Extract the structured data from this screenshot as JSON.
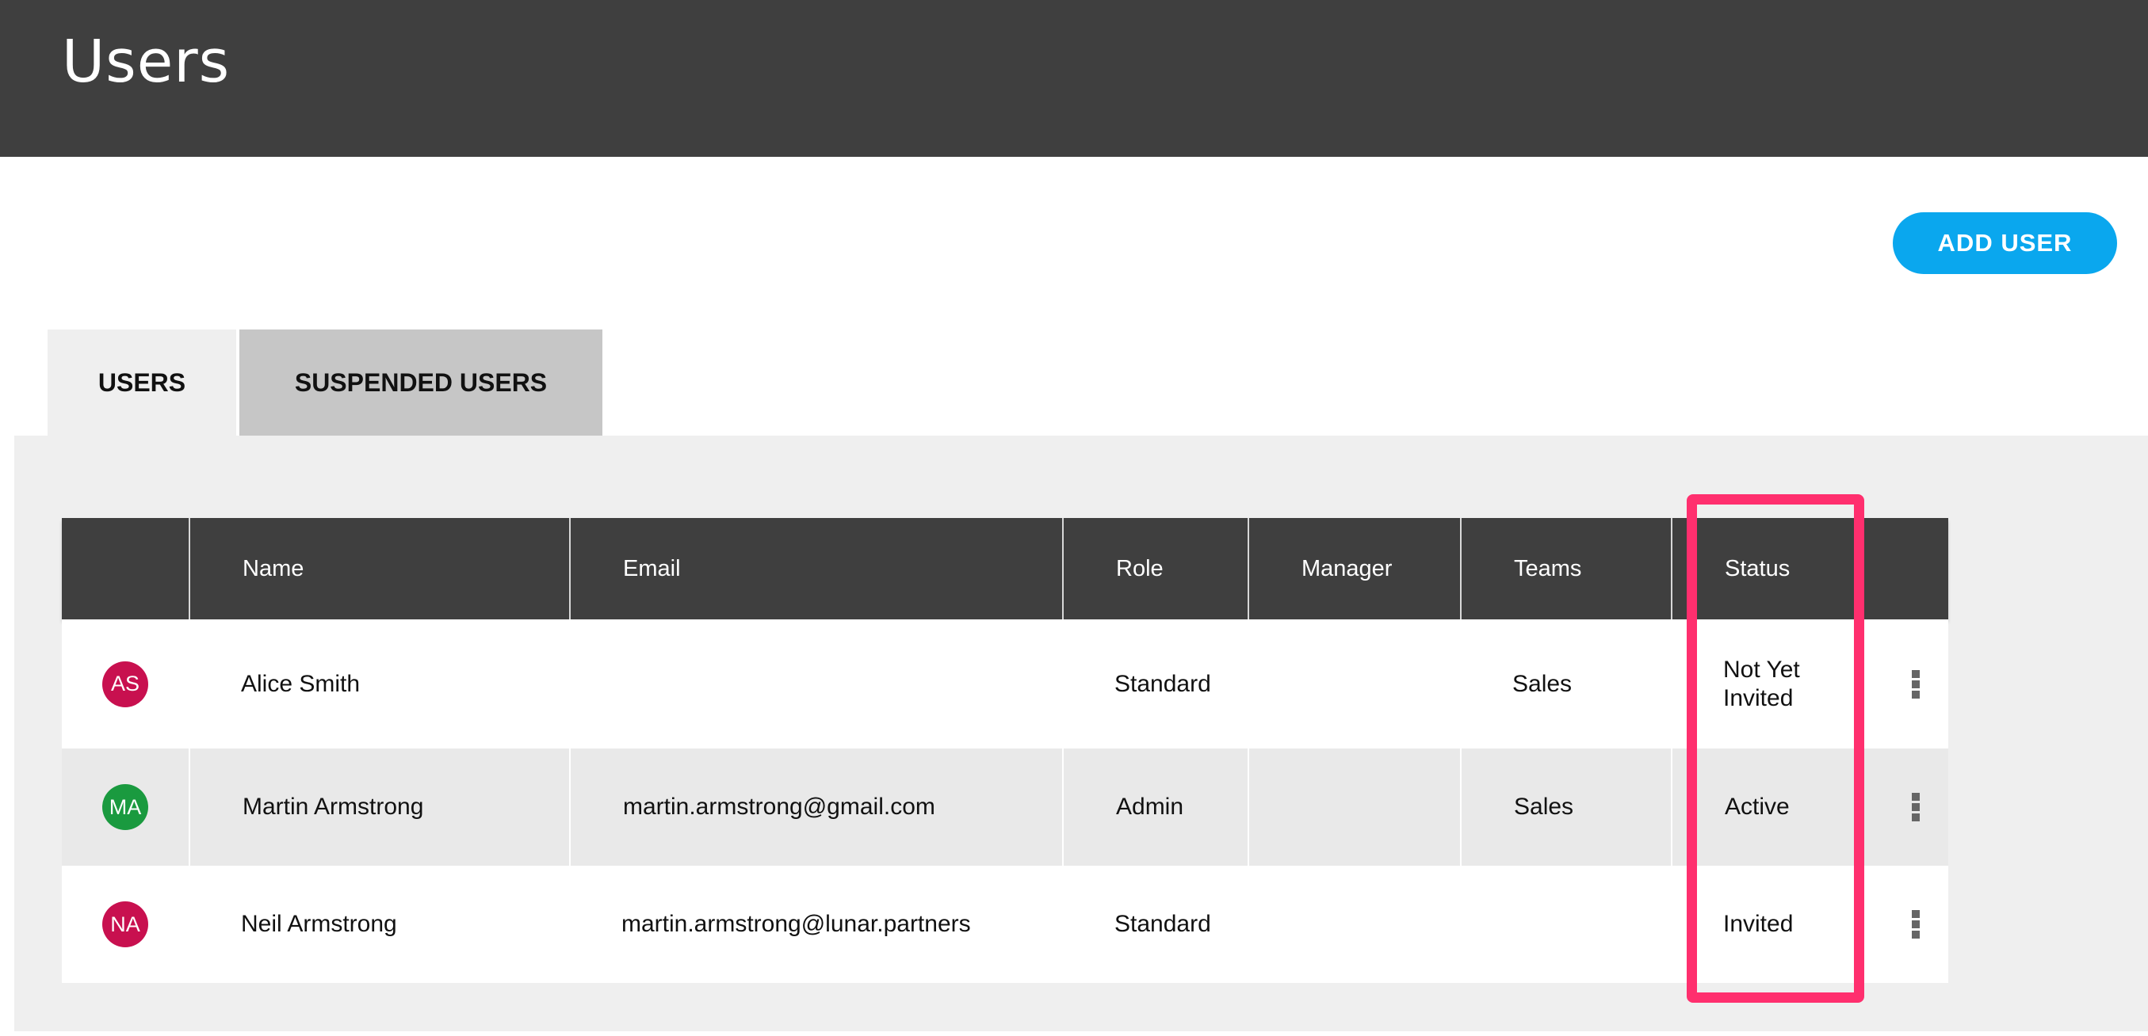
{
  "header": {
    "title": "Users"
  },
  "actions": {
    "add_user": "ADD USER"
  },
  "tabs": [
    {
      "label": "USERS",
      "active": true
    },
    {
      "label": "SUSPENDED USERS",
      "active": false
    }
  ],
  "table": {
    "columns": [
      "",
      "Name",
      "Email",
      "Role",
      "Manager",
      "Teams",
      "Status",
      ""
    ],
    "rows": [
      {
        "initials": "AS",
        "avatar_color": "#c8104f",
        "name": "Alice Smith",
        "email": "",
        "role": "Standard",
        "manager": "",
        "teams": "Sales",
        "status": "Not Yet Invited"
      },
      {
        "initials": "MA",
        "avatar_color": "#1a9a3f",
        "name": "Martin Armstrong",
        "email": "martin.armstrong@gmail.com",
        "role": "Admin",
        "manager": "",
        "teams": "Sales",
        "status": "Active"
      },
      {
        "initials": "NA",
        "avatar_color": "#c8104f",
        "name": "Neil Armstrong",
        "email": "martin.armstrong@lunar.partners",
        "role": "Standard",
        "manager": "",
        "teams": "",
        "status": "Invited"
      }
    ]
  },
  "colors": {
    "header_bg": "#3f3f3f",
    "accent": "#0aa7ee",
    "highlight": "#ff2f6e",
    "panel_bg": "#efefef"
  },
  "icons": {
    "row_menu": "kebab-menu-icon"
  }
}
